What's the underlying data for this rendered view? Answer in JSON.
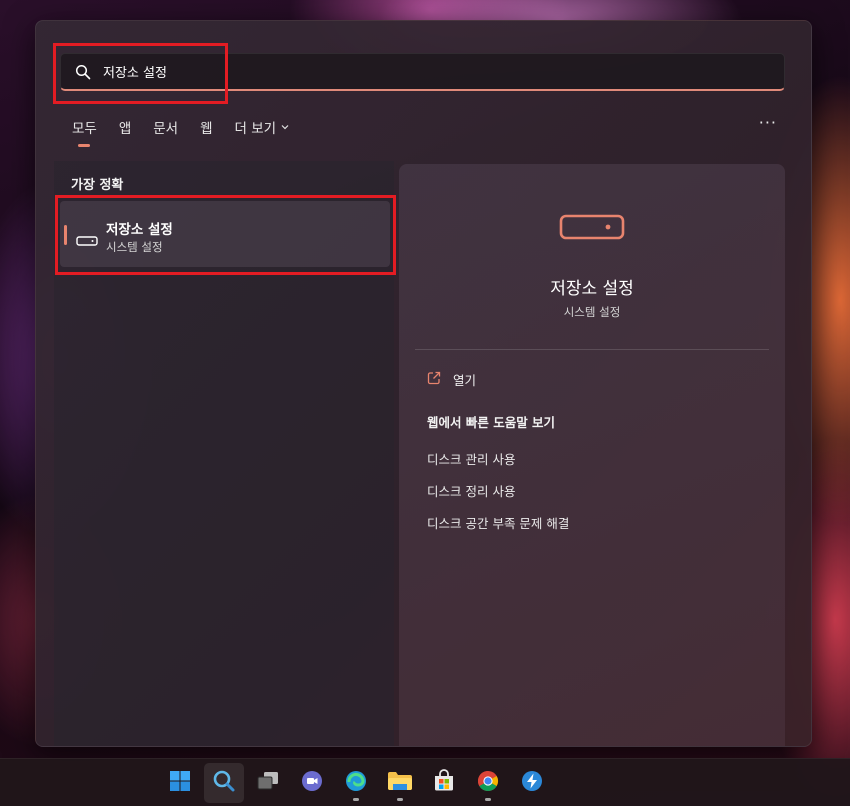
{
  "search": {
    "query": "저장소 설정",
    "placeholder": ""
  },
  "tabs": [
    {
      "label": "모두",
      "active": true
    },
    {
      "label": "앱"
    },
    {
      "label": "문서"
    },
    {
      "label": "웹"
    },
    {
      "label": "더 보기"
    }
  ],
  "more_button": "···",
  "best_match": {
    "heading": "가장 정확",
    "title": "저장소 설정",
    "subtitle": "시스템 설정"
  },
  "preview": {
    "title": "저장소 설정",
    "subtitle": "시스템 설정",
    "open_label": "열기",
    "web_heading": "웹에서 빠른 도움말 보기",
    "links": [
      "디스크 관리 사용",
      "디스크 정리 사용",
      "디스크 공간 부족 문제 해결"
    ]
  },
  "taskbar": {
    "apps": [
      "windows-start",
      "search",
      "task-view",
      "teams-chat",
      "edge",
      "file-explorer",
      "microsoft-store",
      "chrome",
      "quick-assist"
    ]
  },
  "colors": {
    "accent": "#e8846e",
    "highlight": "#e31c23"
  }
}
